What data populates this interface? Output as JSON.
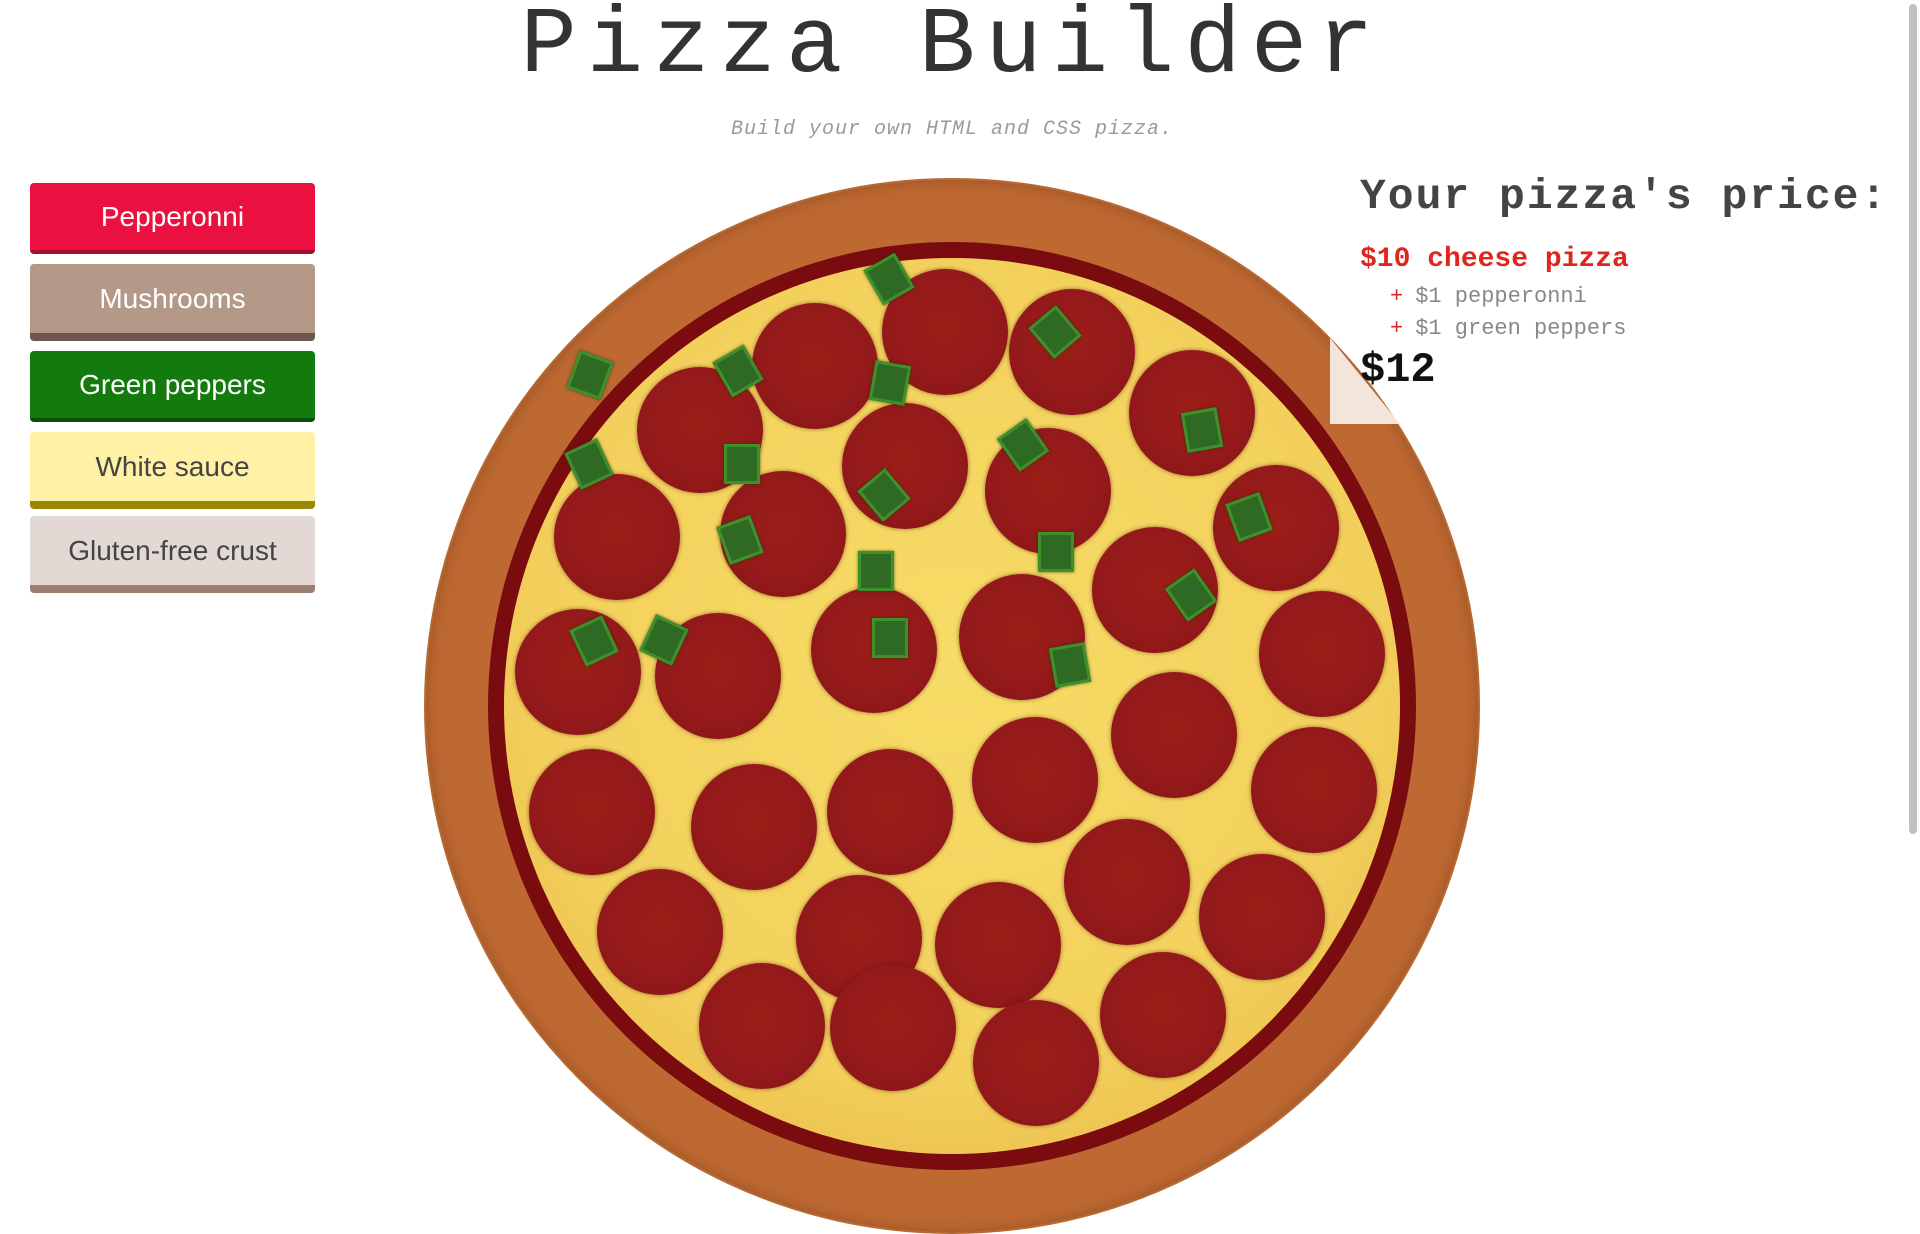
{
  "header": {
    "title": "Pizza Builder",
    "subtitle": "Build your own HTML and CSS pizza."
  },
  "toppings": {
    "pepperoni": "Pepperonni",
    "mushrooms": "Mushrooms",
    "green_peppers": "Green peppers",
    "white_sauce": "White sauce",
    "gluten_free_crust": "Gluten-free crust"
  },
  "price_panel": {
    "title": "Your pizza's price:",
    "base": "$10 cheese pizza",
    "addons": [
      {
        "plus": "+",
        "label": "$1 pepperonni"
      },
      {
        "plus": "+",
        "label": "$1 green peppers"
      }
    ],
    "total": "$12"
  },
  "colors": {
    "pepperoni_button": "#ea1140",
    "mushrooms_button": "#b59988",
    "green_peppers_button": "#137b0d",
    "white_sauce_button": "#fff1a6",
    "gluten_free_button": "#e2d8d4",
    "price_accent": "#e0261c",
    "crust": "#bf6a33",
    "cheese": "#f3d05c",
    "pepperoni": "#94191a",
    "green_pepper": "#2f6a25"
  }
}
